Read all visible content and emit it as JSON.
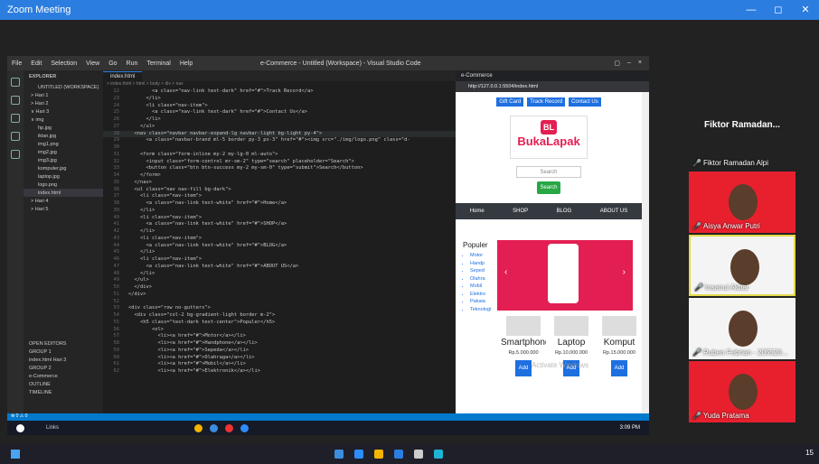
{
  "zoom": {
    "title": "Zoom Meeting",
    "min": "—",
    "max": "◻",
    "close": "✕"
  },
  "vscode": {
    "menu": [
      "File",
      "Edit",
      "Selection",
      "View",
      "Go",
      "Run",
      "Terminal",
      "Help"
    ],
    "title": "e-Commerce - Untitled (Workspace) - Visual Studio Code",
    "explorer_header": "EXPLORER",
    "tree": [
      "UNTITLED (WORKSPACE)",
      "> Hari 1",
      "> Hari 2",
      "∨ Hari 3",
      "∨ img",
      "hp.jpg",
      "iklan.jpg",
      "img1.png",
      "img2.jpg",
      "img3.jpg",
      "komputer.jpg",
      "laptop.jpg",
      "logo.png",
      "index.html",
      "> Hari 4",
      "> Hari 5"
    ],
    "open_editors": [
      "OPEN EDITORS",
      "GROUP 1",
      "index.html Hari 3",
      "GROUP 2",
      "e-Commerce",
      "OUTLINE",
      "TIMELINE"
    ],
    "tab": "index.html",
    "code_lines": [
      {
        "n": "22",
        "t": "        <a class=\"nav-link text-dark\" href=\"#\">Track Record</a>"
      },
      {
        "n": "23",
        "t": "      </li>"
      },
      {
        "n": "24",
        "t": "      <li class=\"nav-item\">"
      },
      {
        "n": "25",
        "t": "        <a class=\"nav-link text-dark\" href=\"#\">Contact Us</a>"
      },
      {
        "n": "26",
        "t": "      </li>"
      },
      {
        "n": "27",
        "t": "    </ul>"
      },
      {
        "n": "28",
        "t": "  <nav class=\"navbar navbar-expand-lg navbar-light bg-light py-4\">"
      },
      {
        "n": "29",
        "t": "      <a class=\"navbar-brand ml-5 border py-3 px-3\" href=\"#\"><img src=\"./img/logo.png\" class=\"d-"
      },
      {
        "n": "30",
        "t": ""
      },
      {
        "n": "31",
        "t": "    <form class=\"form-inline my-2 my-lg-0 ml-auto\">"
      },
      {
        "n": "32",
        "t": "      <input class=\"form-control mr-sm-2\" type=\"search\" placeholder=\"Search\">"
      },
      {
        "n": "33",
        "t": "      <button class=\"btn btn-success my-2 my-sm-0\" type=\"submit\">Search</button>"
      },
      {
        "n": "34",
        "t": "    </form>"
      },
      {
        "n": "35",
        "t": "  </nav>"
      },
      {
        "n": "36",
        "t": "  <ul class=\"nav nav-fill bg-dark\">"
      },
      {
        "n": "37",
        "t": "    <li class=\"nav-item\">"
      },
      {
        "n": "38",
        "t": "      <a class=\"nav-link text-white\" href=\"#\">Home</a>"
      },
      {
        "n": "39",
        "t": "    </li>"
      },
      {
        "n": "40",
        "t": "    <li class=\"nav-item\">"
      },
      {
        "n": "41",
        "t": "      <a class=\"nav-link text-white\" href=\"#\">SHOP</a>"
      },
      {
        "n": "42",
        "t": "    </li>"
      },
      {
        "n": "43",
        "t": "    <li class=\"nav-item\">"
      },
      {
        "n": "44",
        "t": "      <a class=\"nav-link text-white\" href=\"#\">BLOG</a>"
      },
      {
        "n": "45",
        "t": "    </li>"
      },
      {
        "n": "46",
        "t": "    <li class=\"nav-item\">"
      },
      {
        "n": "47",
        "t": "      <a class=\"nav-link text-white\" href=\"#\">ABOUT US</a>"
      },
      {
        "n": "48",
        "t": "    </li>"
      },
      {
        "n": "49",
        "t": "  </ul>"
      },
      {
        "n": "50",
        "t": "  </div>"
      },
      {
        "n": "51",
        "t": "</div>"
      },
      {
        "n": "52",
        "t": ""
      },
      {
        "n": "53",
        "t": "<div class=\"row no-gutters\">"
      },
      {
        "n": "54",
        "t": "  <div class=\"col-2 bg-gradient-light border m-2\">"
      },
      {
        "n": "55",
        "t": "    <h5 class=\"text-dark text-center\">Populer</h5>"
      },
      {
        "n": "56",
        "t": "        <ol>"
      },
      {
        "n": "57",
        "t": "          <li><a href=\"#\">Motor</a></li>"
      },
      {
        "n": "58",
        "t": "          <li><a href=\"#\">Handphone</a></li>"
      },
      {
        "n": "59",
        "t": "          <li><a href=\"#\">Sepeda</a></li>"
      },
      {
        "n": "60",
        "t": "          <li><a href=\"#\">Olahraga</a></li>"
      },
      {
        "n": "61",
        "t": "          <li><a href=\"#\">Mobil</a></li>"
      },
      {
        "n": "62",
        "t": "          <li><a href=\"#\">Elektronik</a></li>"
      }
    ],
    "taskbar_search": "Links",
    "clock": "3:09 PM"
  },
  "browser": {
    "tab": "e-Commerce",
    "url": "http://127.0.0.1:5504/index.html",
    "top_links": [
      "Gift Card",
      "Track Record",
      "Contact Us"
    ],
    "logo_mark": "BL",
    "logo_text": "BukaLapak",
    "search_placeholder": "Search",
    "search_button": "Search",
    "nav": [
      "Home",
      "SHOP",
      "BLOG",
      "ABOUT US"
    ],
    "sidebar_title": "Populer",
    "sidebar_items": [
      "Motor",
      "Handp",
      "Seped",
      "Olahra",
      "Mobil",
      "Elektro",
      "Pakaia",
      "Teknologi"
    ],
    "products": [
      {
        "name": "Smartphone",
        "price": "Rp.5.000.000",
        "add": "Add To"
      },
      {
        "name": "Laptop",
        "price": "Rp.10.000.000",
        "add": "Add To"
      },
      {
        "name": "Komput",
        "price": "Rp.15.000.000",
        "add": "Add To"
      }
    ],
    "watermark": "Activate Windows"
  },
  "participants": {
    "featured": "Fiktor Ramadan...",
    "list": [
      {
        "name": "Fiktor Ramadan Alpi",
        "style": "name-only"
      },
      {
        "name": "Aisya Anwar Putri",
        "style": "red"
      },
      {
        "name": "Insanul Akbar",
        "style": "active"
      },
      {
        "name": "Ruben Febrian - 205520...",
        "style": "white"
      },
      {
        "name": "Yuda Pratama",
        "style": "red"
      }
    ]
  },
  "host_tray": "15"
}
